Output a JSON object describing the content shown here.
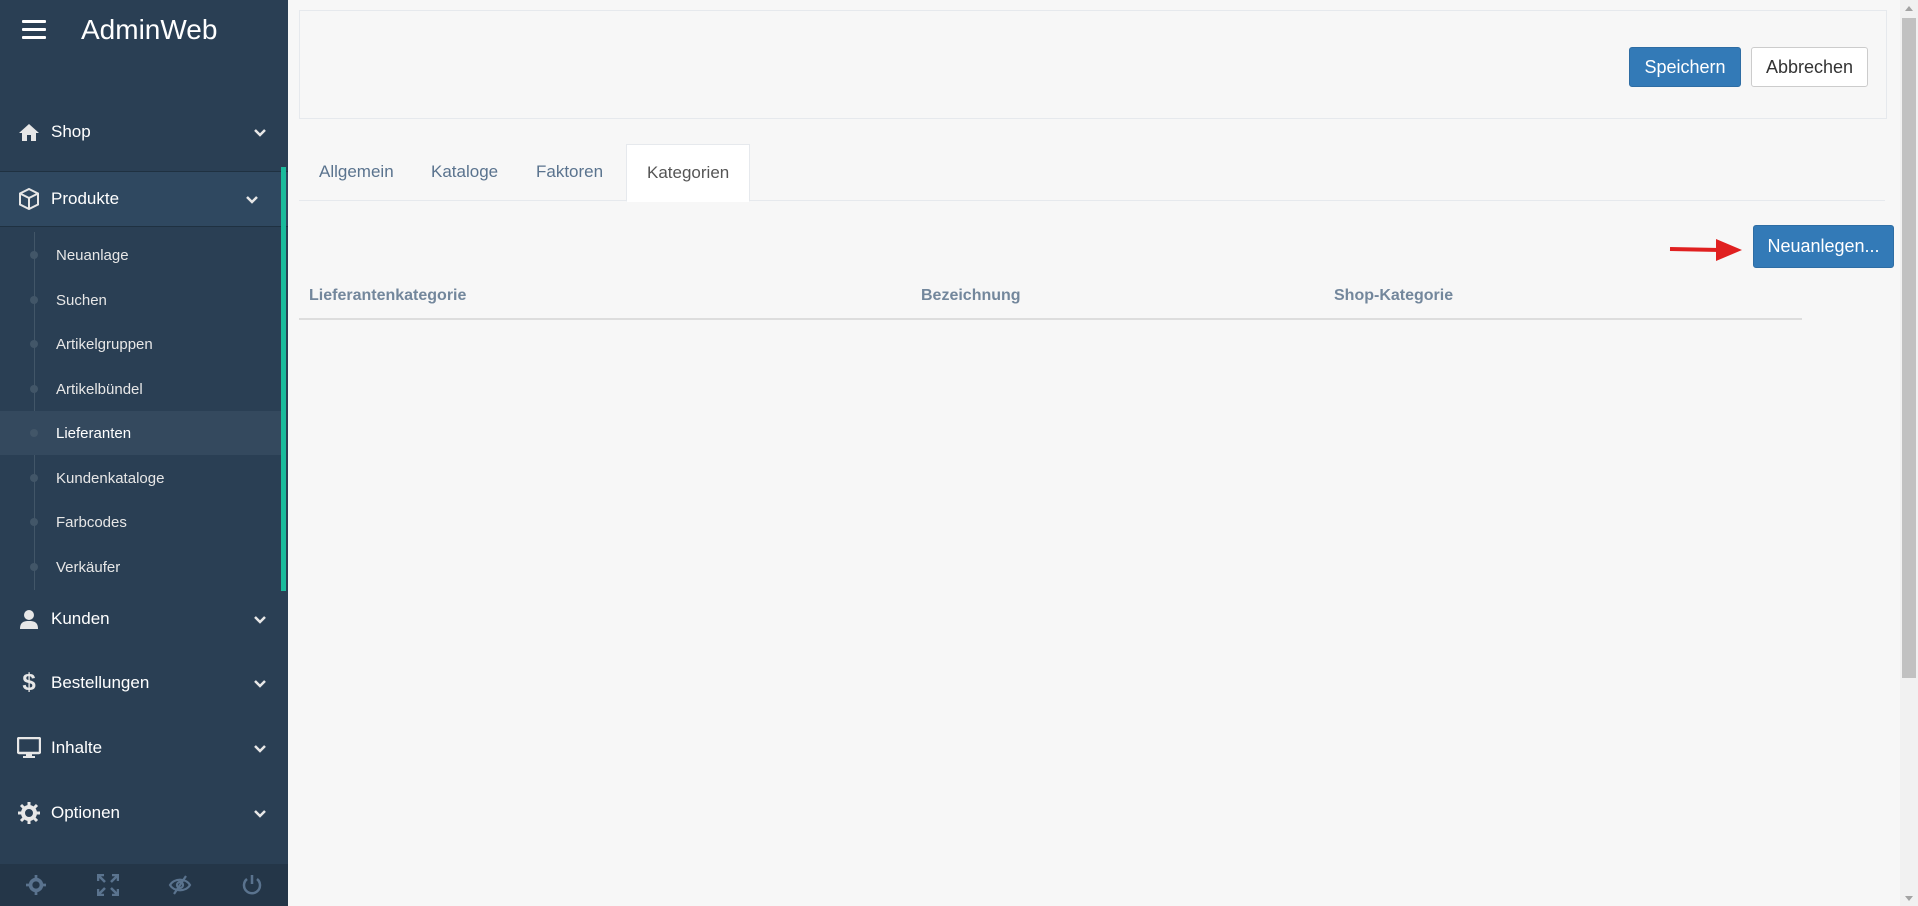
{
  "app": {
    "title": "AdminWeb"
  },
  "sidebar": {
    "menu": [
      {
        "label": "Shop",
        "icon": "home-icon"
      },
      {
        "label": "Produkte",
        "icon": "cube-icon"
      },
      {
        "label": "Kunden",
        "icon": "user-icon"
      },
      {
        "label": "Bestellungen",
        "icon": "dollar-icon"
      },
      {
        "label": "Inhalte",
        "icon": "monitor-icon"
      },
      {
        "label": "Optionen",
        "icon": "gear-icon"
      }
    ],
    "submenu": [
      {
        "label": "Neuanlage"
      },
      {
        "label": "Suchen"
      },
      {
        "label": "Artikelgruppen"
      },
      {
        "label": "Artikelbündel"
      },
      {
        "label": "Lieferanten"
      },
      {
        "label": "Kundenkataloge"
      },
      {
        "label": "Farbcodes"
      },
      {
        "label": "Verkäufer"
      }
    ],
    "current_submenu": "Lieferanten",
    "footer_icons": [
      "settings-icon",
      "fullscreen-icon",
      "eye-slash-icon",
      "power-icon"
    ]
  },
  "toolbar": {
    "save_label": "Speichern",
    "cancel_label": "Abbrechen"
  },
  "tabs": [
    {
      "label": "Allgemein"
    },
    {
      "label": "Kataloge"
    },
    {
      "label": "Faktoren"
    },
    {
      "label": "Kategorien"
    }
  ],
  "active_tab": "Kategorien",
  "actions": {
    "new_label": "Neuanlegen..."
  },
  "table": {
    "columns": [
      "Lieferantenkategorie",
      "Bezeichnung",
      "Shop-Kategorie"
    ]
  },
  "colors": {
    "sidebar_bg": "#2a3f54",
    "accent": "#1abb9c",
    "primary": "#337ab7",
    "arrow": "#e02020"
  }
}
